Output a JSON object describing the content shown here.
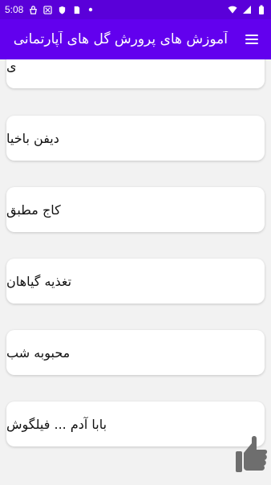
{
  "status": {
    "time": "5:08"
  },
  "appbar": {
    "title": "آموزش های پرورش گل های آپارتمانی"
  },
  "items": [
    {
      "label": "ی"
    },
    {
      "label": "دیفن باخیا"
    },
    {
      "label": "کاج مطبق"
    },
    {
      "label": "تغذیه گیاهان"
    },
    {
      "label": "محبوبه شب"
    },
    {
      "label": "بابا آدم ... فیلگوش"
    }
  ],
  "colors": {
    "appbar": "#6200ee",
    "statusbar": "#5a00d9"
  }
}
